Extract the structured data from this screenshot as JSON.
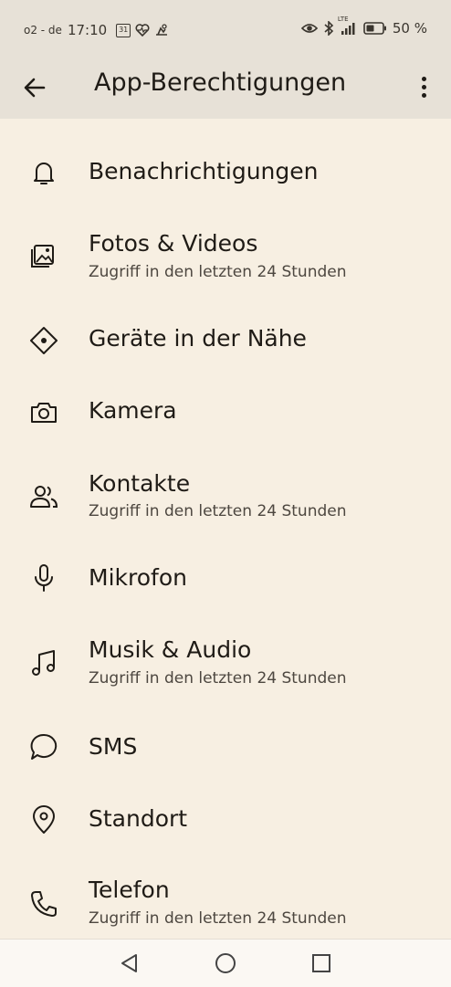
{
  "status_bar": {
    "carrier": "o2 - de",
    "time": "17:10",
    "calendar_day": "31",
    "battery_percent": "50 %",
    "network": "LTE"
  },
  "app_bar": {
    "title": "App-Berechtigungen"
  },
  "permissions": [
    {
      "label": "Benachrichtigungen",
      "sub": "",
      "icon": "bell-icon"
    },
    {
      "label": "Fotos & Videos",
      "sub": "Zugriff in den letzten 24 Stunden",
      "icon": "photos-icon"
    },
    {
      "label": "Geräte in der Nähe",
      "sub": "",
      "icon": "nearby-devices-icon"
    },
    {
      "label": "Kamera",
      "sub": "",
      "icon": "camera-icon"
    },
    {
      "label": "Kontakte",
      "sub": "Zugriff in den letzten 24 Stunden",
      "icon": "contacts-icon"
    },
    {
      "label": "Mikrofon",
      "sub": "",
      "icon": "microphone-icon"
    },
    {
      "label": "Musik & Audio",
      "sub": "Zugriff in den letzten 24 Stunden",
      "icon": "music-icon"
    },
    {
      "label": "SMS",
      "sub": "",
      "icon": "sms-icon"
    },
    {
      "label": "Standort",
      "sub": "",
      "icon": "location-icon"
    },
    {
      "label": "Telefon",
      "sub": "Zugriff in den letzten 24 Stunden",
      "icon": "phone-icon"
    }
  ],
  "nav_bar": {
    "back": "back-triangle-icon",
    "home": "home-circle-icon",
    "recents": "recents-square-icon"
  }
}
